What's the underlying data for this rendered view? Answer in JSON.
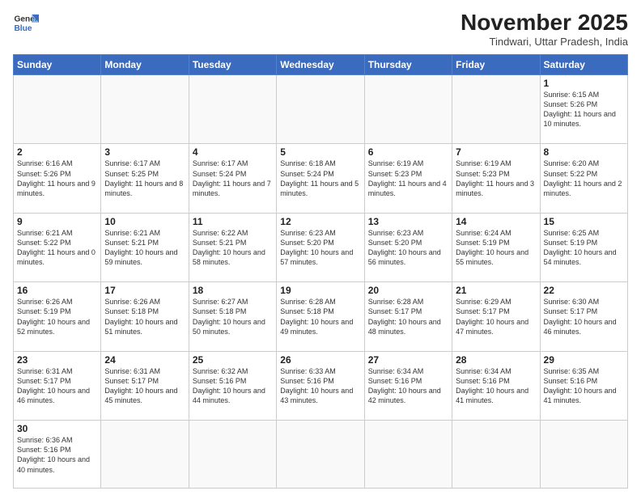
{
  "logo": {
    "line1": "General",
    "line2": "Blue"
  },
  "title": "November 2025",
  "location": "Tindwari, Uttar Pradesh, India",
  "days_of_week": [
    "Sunday",
    "Monday",
    "Tuesday",
    "Wednesday",
    "Thursday",
    "Friday",
    "Saturday"
  ],
  "weeks": [
    [
      {
        "day": "",
        "info": ""
      },
      {
        "day": "",
        "info": ""
      },
      {
        "day": "",
        "info": ""
      },
      {
        "day": "",
        "info": ""
      },
      {
        "day": "",
        "info": ""
      },
      {
        "day": "",
        "info": ""
      },
      {
        "day": "1",
        "info": "Sunrise: 6:15 AM\nSunset: 5:26 PM\nDaylight: 11 hours\nand 10 minutes."
      }
    ],
    [
      {
        "day": "2",
        "info": "Sunrise: 6:16 AM\nSunset: 5:26 PM\nDaylight: 11 hours\nand 9 minutes."
      },
      {
        "day": "3",
        "info": "Sunrise: 6:17 AM\nSunset: 5:25 PM\nDaylight: 11 hours\nand 8 minutes."
      },
      {
        "day": "4",
        "info": "Sunrise: 6:17 AM\nSunset: 5:24 PM\nDaylight: 11 hours\nand 7 minutes."
      },
      {
        "day": "5",
        "info": "Sunrise: 6:18 AM\nSunset: 5:24 PM\nDaylight: 11 hours\nand 5 minutes."
      },
      {
        "day": "6",
        "info": "Sunrise: 6:19 AM\nSunset: 5:23 PM\nDaylight: 11 hours\nand 4 minutes."
      },
      {
        "day": "7",
        "info": "Sunrise: 6:19 AM\nSunset: 5:23 PM\nDaylight: 11 hours\nand 3 minutes."
      },
      {
        "day": "8",
        "info": "Sunrise: 6:20 AM\nSunset: 5:22 PM\nDaylight: 11 hours\nand 2 minutes."
      }
    ],
    [
      {
        "day": "9",
        "info": "Sunrise: 6:21 AM\nSunset: 5:22 PM\nDaylight: 11 hours\nand 0 minutes."
      },
      {
        "day": "10",
        "info": "Sunrise: 6:21 AM\nSunset: 5:21 PM\nDaylight: 10 hours\nand 59 minutes."
      },
      {
        "day": "11",
        "info": "Sunrise: 6:22 AM\nSunset: 5:21 PM\nDaylight: 10 hours\nand 58 minutes."
      },
      {
        "day": "12",
        "info": "Sunrise: 6:23 AM\nSunset: 5:20 PM\nDaylight: 10 hours\nand 57 minutes."
      },
      {
        "day": "13",
        "info": "Sunrise: 6:23 AM\nSunset: 5:20 PM\nDaylight: 10 hours\nand 56 minutes."
      },
      {
        "day": "14",
        "info": "Sunrise: 6:24 AM\nSunset: 5:19 PM\nDaylight: 10 hours\nand 55 minutes."
      },
      {
        "day": "15",
        "info": "Sunrise: 6:25 AM\nSunset: 5:19 PM\nDaylight: 10 hours\nand 54 minutes."
      }
    ],
    [
      {
        "day": "16",
        "info": "Sunrise: 6:26 AM\nSunset: 5:19 PM\nDaylight: 10 hours\nand 52 minutes."
      },
      {
        "day": "17",
        "info": "Sunrise: 6:26 AM\nSunset: 5:18 PM\nDaylight: 10 hours\nand 51 minutes."
      },
      {
        "day": "18",
        "info": "Sunrise: 6:27 AM\nSunset: 5:18 PM\nDaylight: 10 hours\nand 50 minutes."
      },
      {
        "day": "19",
        "info": "Sunrise: 6:28 AM\nSunset: 5:18 PM\nDaylight: 10 hours\nand 49 minutes."
      },
      {
        "day": "20",
        "info": "Sunrise: 6:28 AM\nSunset: 5:17 PM\nDaylight: 10 hours\nand 48 minutes."
      },
      {
        "day": "21",
        "info": "Sunrise: 6:29 AM\nSunset: 5:17 PM\nDaylight: 10 hours\nand 47 minutes."
      },
      {
        "day": "22",
        "info": "Sunrise: 6:30 AM\nSunset: 5:17 PM\nDaylight: 10 hours\nand 46 minutes."
      }
    ],
    [
      {
        "day": "23",
        "info": "Sunrise: 6:31 AM\nSunset: 5:17 PM\nDaylight: 10 hours\nand 46 minutes."
      },
      {
        "day": "24",
        "info": "Sunrise: 6:31 AM\nSunset: 5:17 PM\nDaylight: 10 hours\nand 45 minutes."
      },
      {
        "day": "25",
        "info": "Sunrise: 6:32 AM\nSunset: 5:16 PM\nDaylight: 10 hours\nand 44 minutes."
      },
      {
        "day": "26",
        "info": "Sunrise: 6:33 AM\nSunset: 5:16 PM\nDaylight: 10 hours\nand 43 minutes."
      },
      {
        "day": "27",
        "info": "Sunrise: 6:34 AM\nSunset: 5:16 PM\nDaylight: 10 hours\nand 42 minutes."
      },
      {
        "day": "28",
        "info": "Sunrise: 6:34 AM\nSunset: 5:16 PM\nDaylight: 10 hours\nand 41 minutes."
      },
      {
        "day": "29",
        "info": "Sunrise: 6:35 AM\nSunset: 5:16 PM\nDaylight: 10 hours\nand 41 minutes."
      }
    ],
    [
      {
        "day": "30",
        "info": "Sunrise: 6:36 AM\nSunset: 5:16 PM\nDaylight: 10 hours\nand 40 minutes."
      },
      {
        "day": "",
        "info": ""
      },
      {
        "day": "",
        "info": ""
      },
      {
        "day": "",
        "info": ""
      },
      {
        "day": "",
        "info": ""
      },
      {
        "day": "",
        "info": ""
      },
      {
        "day": "",
        "info": ""
      }
    ]
  ]
}
